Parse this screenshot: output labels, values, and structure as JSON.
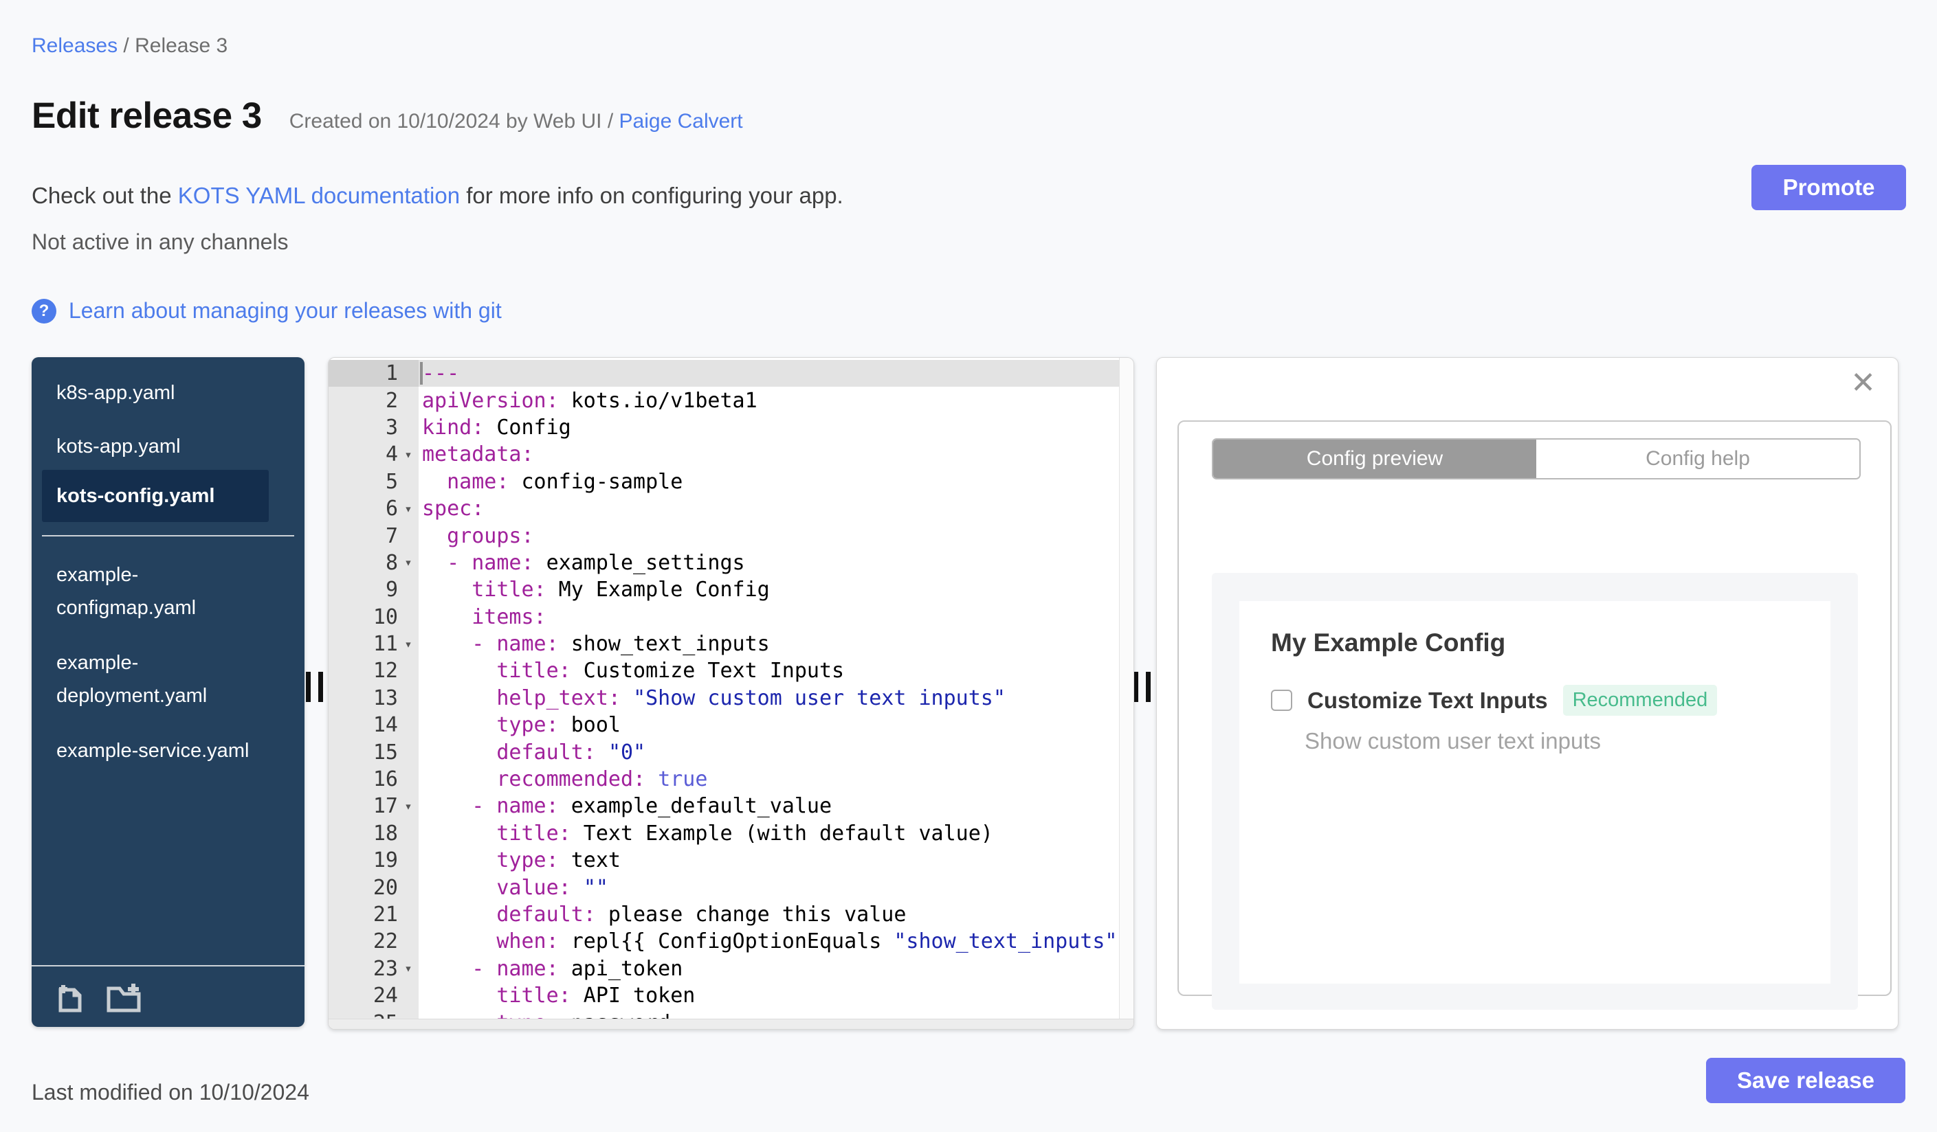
{
  "breadcrumb": {
    "link": "Releases",
    "separator": " / ",
    "current": "Release 3"
  },
  "header": {
    "title": "Edit release 3",
    "created_prefix": "Created on 10/10/2024 by Web UI / ",
    "created_author": "Paige Calvert",
    "promote_label": "Promote"
  },
  "intro": {
    "before_link": "Check out the ",
    "link_text": "KOTS YAML documentation",
    "after_link": " for more info on configuring your app.",
    "channel_status": "Not active in any channels"
  },
  "git_link": {
    "icon_glyph": "?",
    "label": "Learn about managing your releases with git"
  },
  "file_tree": {
    "files_top": [
      {
        "label": "k8s-app.yaml",
        "active": false
      },
      {
        "label": "kots-app.yaml",
        "active": false
      },
      {
        "label": "kots-config.yaml",
        "active": true
      }
    ],
    "files_bottom": [
      {
        "label": "example-configmap.yaml"
      },
      {
        "label": "example-deployment.yaml"
      },
      {
        "label": "example-service.yaml"
      }
    ],
    "actions": [
      {
        "icon": "add-file-icon"
      },
      {
        "icon": "add-folder-icon"
      }
    ]
  },
  "editor": {
    "lines": [
      {
        "n": 1,
        "fold": false,
        "active": true,
        "parts": [
          {
            "t": "doc",
            "s": "---"
          }
        ]
      },
      {
        "n": 2,
        "fold": false,
        "parts": [
          {
            "t": "key",
            "s": "apiVersion:"
          },
          {
            "t": "plain",
            "s": " kots.io/v1beta1"
          }
        ]
      },
      {
        "n": 3,
        "fold": false,
        "parts": [
          {
            "t": "key",
            "s": "kind:"
          },
          {
            "t": "plain",
            "s": " Config"
          }
        ]
      },
      {
        "n": 4,
        "fold": true,
        "parts": [
          {
            "t": "key",
            "s": "metadata:"
          }
        ]
      },
      {
        "n": 5,
        "fold": false,
        "parts": [
          {
            "t": "plain",
            "s": "  "
          },
          {
            "t": "key",
            "s": "name:"
          },
          {
            "t": "plain",
            "s": " config-sample"
          }
        ]
      },
      {
        "n": 6,
        "fold": true,
        "parts": [
          {
            "t": "key",
            "s": "spec:"
          }
        ]
      },
      {
        "n": 7,
        "fold": false,
        "parts": [
          {
            "t": "plain",
            "s": "  "
          },
          {
            "t": "key",
            "s": "groups:"
          }
        ]
      },
      {
        "n": 8,
        "fold": true,
        "parts": [
          {
            "t": "plain",
            "s": "  "
          },
          {
            "t": "dash",
            "s": "- "
          },
          {
            "t": "key",
            "s": "name:"
          },
          {
            "t": "plain",
            "s": " example_settings"
          }
        ]
      },
      {
        "n": 9,
        "fold": false,
        "parts": [
          {
            "t": "plain",
            "s": "    "
          },
          {
            "t": "key",
            "s": "title:"
          },
          {
            "t": "plain",
            "s": " My Example Config"
          }
        ]
      },
      {
        "n": 10,
        "fold": false,
        "parts": [
          {
            "t": "plain",
            "s": "    "
          },
          {
            "t": "key",
            "s": "items:"
          }
        ]
      },
      {
        "n": 11,
        "fold": true,
        "parts": [
          {
            "t": "plain",
            "s": "    "
          },
          {
            "t": "dash",
            "s": "- "
          },
          {
            "t": "key",
            "s": "name:"
          },
          {
            "t": "plain",
            "s": " show_text_inputs"
          }
        ]
      },
      {
        "n": 12,
        "fold": false,
        "parts": [
          {
            "t": "plain",
            "s": "      "
          },
          {
            "t": "key",
            "s": "title:"
          },
          {
            "t": "plain",
            "s": " Customize Text Inputs"
          }
        ]
      },
      {
        "n": 13,
        "fold": false,
        "parts": [
          {
            "t": "plain",
            "s": "      "
          },
          {
            "t": "key",
            "s": "help_text:"
          },
          {
            "t": "plain",
            "s": " "
          },
          {
            "t": "str",
            "s": "\"Show custom user text inputs\""
          }
        ]
      },
      {
        "n": 14,
        "fold": false,
        "parts": [
          {
            "t": "plain",
            "s": "      "
          },
          {
            "t": "key",
            "s": "type:"
          },
          {
            "t": "plain",
            "s": " bool"
          }
        ]
      },
      {
        "n": 15,
        "fold": false,
        "parts": [
          {
            "t": "plain",
            "s": "      "
          },
          {
            "t": "key",
            "s": "default:"
          },
          {
            "t": "plain",
            "s": " "
          },
          {
            "t": "str",
            "s": "\"0\""
          }
        ]
      },
      {
        "n": 16,
        "fold": false,
        "parts": [
          {
            "t": "plain",
            "s": "      "
          },
          {
            "t": "key",
            "s": "recommended:"
          },
          {
            "t": "plain",
            "s": " "
          },
          {
            "t": "const",
            "s": "true"
          }
        ]
      },
      {
        "n": 17,
        "fold": true,
        "parts": [
          {
            "t": "plain",
            "s": "    "
          },
          {
            "t": "dash",
            "s": "- "
          },
          {
            "t": "key",
            "s": "name:"
          },
          {
            "t": "plain",
            "s": " example_default_value"
          }
        ]
      },
      {
        "n": 18,
        "fold": false,
        "parts": [
          {
            "t": "plain",
            "s": "      "
          },
          {
            "t": "key",
            "s": "title:"
          },
          {
            "t": "plain",
            "s": " Text Example (with default value)"
          }
        ]
      },
      {
        "n": 19,
        "fold": false,
        "parts": [
          {
            "t": "plain",
            "s": "      "
          },
          {
            "t": "key",
            "s": "type:"
          },
          {
            "t": "plain",
            "s": " text"
          }
        ]
      },
      {
        "n": 20,
        "fold": false,
        "parts": [
          {
            "t": "plain",
            "s": "      "
          },
          {
            "t": "key",
            "s": "value:"
          },
          {
            "t": "plain",
            "s": " "
          },
          {
            "t": "str",
            "s": "\"\""
          }
        ]
      },
      {
        "n": 21,
        "fold": false,
        "parts": [
          {
            "t": "plain",
            "s": "      "
          },
          {
            "t": "key",
            "s": "default:"
          },
          {
            "t": "plain",
            "s": " please change this value"
          }
        ]
      },
      {
        "n": 22,
        "fold": false,
        "parts": [
          {
            "t": "plain",
            "s": "      "
          },
          {
            "t": "key",
            "s": "when:"
          },
          {
            "t": "plain",
            "s": " repl{{ ConfigOptionEquals "
          },
          {
            "t": "str",
            "s": "\"show_text_inputs\""
          }
        ]
      },
      {
        "n": 23,
        "fold": true,
        "parts": [
          {
            "t": "plain",
            "s": "    "
          },
          {
            "t": "dash",
            "s": "- "
          },
          {
            "t": "key",
            "s": "name:"
          },
          {
            "t": "plain",
            "s": " api_token"
          }
        ]
      },
      {
        "n": 24,
        "fold": false,
        "parts": [
          {
            "t": "plain",
            "s": "      "
          },
          {
            "t": "key",
            "s": "title:"
          },
          {
            "t": "plain",
            "s": " API token"
          }
        ]
      },
      {
        "n": 25,
        "fold": false,
        "parts": [
          {
            "t": "plain",
            "s": "      "
          },
          {
            "t": "key",
            "s": "type:"
          },
          {
            "t": "plain",
            "s": " password"
          }
        ]
      }
    ]
  },
  "preview": {
    "close_glyph": "✕",
    "tabs": [
      {
        "label": "Config preview",
        "active": true
      },
      {
        "label": "Config help",
        "active": false
      }
    ],
    "group_title": "My Example Config",
    "item": {
      "label": "Customize Text Inputs",
      "badge": "Recommended",
      "help_text": "Show custom user text inputs",
      "checked": false
    }
  },
  "footer": {
    "last_modified": "Last modified on 10/10/2024",
    "save_label": "Save release"
  },
  "colors": {
    "accent_blue": "#4d7ceb",
    "button_purple": "#6e75f0",
    "sidebar_bg": "#24415e",
    "sidebar_active_bg": "#142e4d",
    "yaml_key": "#a0219b",
    "yaml_string": "#1c26ad",
    "yaml_const": "#5a5cd6",
    "badge_green_text": "#47bb8c",
    "badge_green_bg": "#e7f7ef",
    "tab_active_bg": "#9b9b9b"
  }
}
